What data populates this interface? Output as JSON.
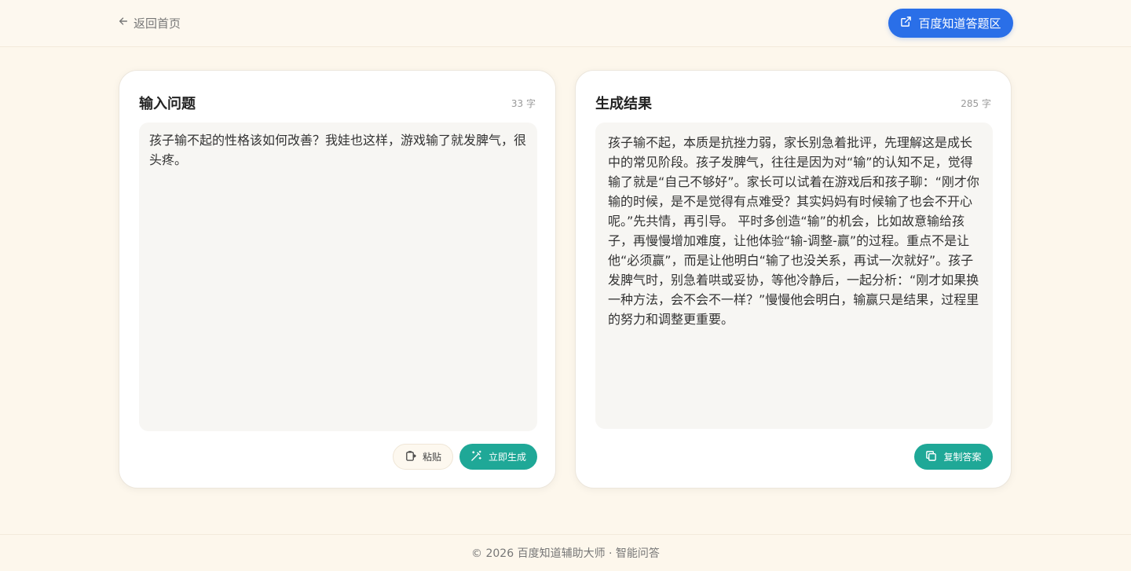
{
  "header": {
    "back_label": "返回首页",
    "zhidao_button_label": "百度知道答题区",
    "accent_color": "#2a6fe8"
  },
  "input_panel": {
    "title": "输入问题",
    "char_count": "33 字",
    "text": "孩子输不起的性格该如何改善？我娃也这样，游戏输了就发脾气，很头疼。",
    "paste_label": "粘贴",
    "generate_label": "立即生成"
  },
  "output_panel": {
    "title": "生成结果",
    "char_count": "285 字",
    "text": "孩子输不起，本质是抗挫力弱，家长别急着批评，先理解这是成长中的常见阶段。孩子发脾气，往往是因为对“输”的认知不足，觉得输了就是“自己不够好”。家长可以试着在游戏后和孩子聊：“刚才你输的时候，是不是觉得有点难受？其实妈妈有时候输了也会不开心呢。”先共情，再引导。 平时多创造“输”的机会，比如故意输给孩子，再慢慢增加难度，让他体验“输-调整-赢”的过程。重点不是让他“必须赢”，而是让他明白“输了也没关系，再试一次就好”。孩子发脾气时，别急着哄或妥协，等他冷静后，一起分析：“刚才如果换一种方法，会不会不一样？”慢慢他会明白，输赢只是结果，过程里的努力和调整更重要。",
    "copy_label": "复制答案",
    "button_color": "#1fa897"
  },
  "footer": {
    "text": "© 2026 百度知道辅助大师 · 智能问答"
  },
  "icons": [
    "arrow-left-icon",
    "external-link-icon",
    "clipboard-icon",
    "magic-wand-icon",
    "copy-icon"
  ]
}
